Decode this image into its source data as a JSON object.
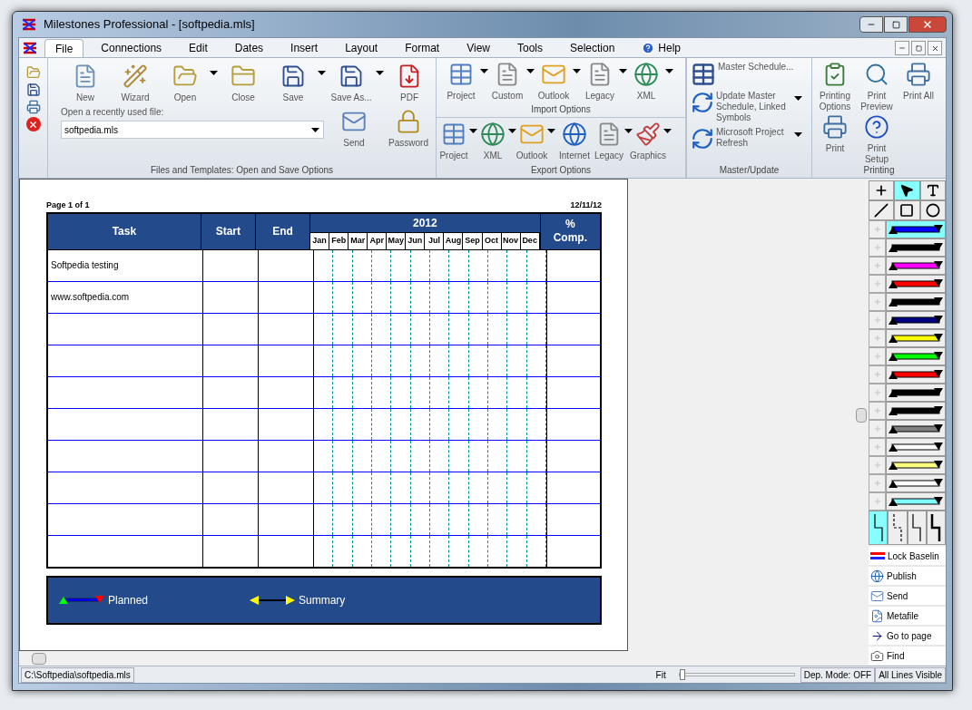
{
  "window": {
    "title": "Milestones Professional - [softpedia.mls]"
  },
  "menu": [
    {
      "label": "File",
      "selected": true
    },
    {
      "label": "Connections",
      "selected": false
    },
    {
      "label": "Edit",
      "selected": false
    },
    {
      "label": "Dates",
      "selected": false
    },
    {
      "label": "Insert",
      "selected": false
    },
    {
      "label": "Layout",
      "selected": false
    },
    {
      "label": "Format",
      "selected": false
    },
    {
      "label": "View",
      "selected": false
    },
    {
      "label": "Tools",
      "selected": false
    },
    {
      "label": "Selection",
      "selected": false
    },
    {
      "label": "Help",
      "selected": false
    }
  ],
  "files_group": {
    "title": "Files and Templates: Open and Save Options",
    "buttons": [
      {
        "label": "New",
        "kind": "new",
        "dropdown": false
      },
      {
        "label": "Wizard",
        "kind": "wizard",
        "dropdown": false
      },
      {
        "label": "Open",
        "kind": "open",
        "dropdown": true
      },
      {
        "label": "Close",
        "kind": "close",
        "dropdown": false
      },
      {
        "label": "Save",
        "kind": "save",
        "dropdown": true
      },
      {
        "label": "Save As...",
        "kind": "saveas",
        "dropdown": true
      },
      {
        "label": "PDF",
        "kind": "pdf",
        "dropdown": false
      }
    ],
    "recent_label": "Open a recently used file:",
    "recent_value": "softpedia.mls",
    "extra": [
      {
        "label": "Send",
        "kind": "send"
      },
      {
        "label": "Password",
        "kind": "lock"
      }
    ]
  },
  "import_group": {
    "title": "Import Options",
    "buttons": [
      {
        "label": "Project",
        "kind": "project"
      },
      {
        "label": "Custom",
        "kind": "doc"
      },
      {
        "label": "Outlook",
        "kind": "outlook"
      },
      {
        "label": "Legacy",
        "kind": "doc"
      },
      {
        "label": "XML",
        "kind": "xml"
      }
    ]
  },
  "export_group": {
    "title": "Export Options",
    "buttons": [
      {
        "label": "Project",
        "kind": "project"
      },
      {
        "label": "XML",
        "kind": "xml"
      },
      {
        "label": "Outlook",
        "kind": "outlook"
      },
      {
        "label": "Internet",
        "kind": "internet"
      },
      {
        "label": "Legacy",
        "kind": "doc"
      },
      {
        "label": "Graphics",
        "kind": "graphics"
      }
    ]
  },
  "master_group": {
    "title": "Master/Update",
    "items": [
      {
        "label": "Master Schedule...",
        "dropdown": false
      },
      {
        "label": "Update Master Schedule, Linked Symbols",
        "dropdown": true
      },
      {
        "label": "Microsoft Project Refresh",
        "dropdown": true
      }
    ]
  },
  "printing_group": {
    "title": "Printing",
    "buttons": [
      {
        "label": "Printing Options",
        "kind": "options"
      },
      {
        "label": "Print Preview",
        "kind": "preview"
      },
      {
        "label": "Print All",
        "kind": "print"
      },
      {
        "label": "Print",
        "kind": "print"
      },
      {
        "label": "Print Setup",
        "kind": "setup"
      }
    ]
  },
  "sheet": {
    "page": "Page 1 of 1",
    "date": "12/11/12",
    "columns": [
      "Task",
      "Start",
      "End"
    ],
    "year": "2012",
    "months": [
      "Jan",
      "Feb",
      "Mar",
      "Apr",
      "May",
      "Jun",
      "Jul",
      "Aug",
      "Sep",
      "Oct",
      "Nov",
      "Dec"
    ],
    "pct": "% Comp.",
    "rows": [
      {
        "task": "Softpedia testing"
      },
      {
        "task": "www.softpedia.com"
      }
    ],
    "legend": [
      {
        "label": "Planned",
        "kind": "planned"
      },
      {
        "label": "Summary",
        "kind": "summary"
      }
    ]
  },
  "palette": {
    "tools": [
      {
        "kind": "plus",
        "selected": false
      },
      {
        "kind": "pointer",
        "selected": true
      },
      {
        "kind": "text",
        "selected": false
      },
      {
        "kind": "line",
        "selected": false
      },
      {
        "kind": "rect",
        "selected": false
      },
      {
        "kind": "circle",
        "selected": false
      }
    ],
    "styles": [
      {
        "color": "#0000ff",
        "selected": true
      },
      {
        "color": "#000000",
        "selected": false
      },
      {
        "color": "#ff00ff",
        "selected": false
      },
      {
        "color": "#ff0000",
        "selected": false
      },
      {
        "color": "#000000",
        "selected": false
      },
      {
        "color": "#000080",
        "selected": false
      },
      {
        "color": "#ffff00",
        "selected": false
      },
      {
        "color": "#00ff00",
        "selected": false
      },
      {
        "color": "#ff0000",
        "selected": false
      },
      {
        "color": "#000000",
        "selected": false
      },
      {
        "color": "#000000",
        "selected": false
      },
      {
        "color": "#808080",
        "selected": false
      },
      {
        "color": "#ffffff",
        "selected": false
      },
      {
        "color": "#ffff80",
        "selected": false
      },
      {
        "color": "#ffffff",
        "selected": false
      },
      {
        "color": "#80ffff",
        "selected": false
      }
    ],
    "connectors": [
      {
        "selected": true
      },
      {
        "selected": false
      },
      {
        "selected": false
      },
      {
        "selected": false
      }
    ],
    "actions": [
      {
        "label": "Lock Baselin",
        "kind": "lock"
      },
      {
        "label": "Publish",
        "kind": "publish"
      },
      {
        "label": "Send",
        "kind": "send"
      },
      {
        "label": "Metafile",
        "kind": "metafile"
      },
      {
        "label": "Go to page",
        "kind": "goto"
      },
      {
        "label": "Find",
        "kind": "find"
      }
    ]
  },
  "status_bar": {
    "path": "C:\\Softpedia\\softpedia.mls",
    "zoom_label": "Fit",
    "zoom": {
      "level": 0.0
    },
    "dep_mode": "Dep. Mode: OFF",
    "lines": "All Lines Visible"
  }
}
